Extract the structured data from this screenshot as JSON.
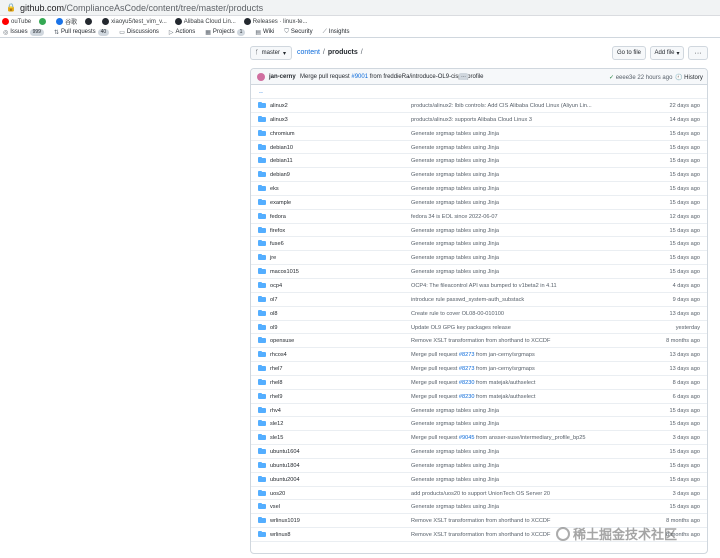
{
  "browser": {
    "host": "github.com",
    "path": "/ComplianceAsCode/content/tree/master/products"
  },
  "bookmarks": [
    {
      "label": "ouTube",
      "icon": "youtube-icon",
      "color": "#ff0000"
    },
    {
      "label": "",
      "icon": "maps-pin-icon",
      "color": "#34a853"
    },
    {
      "label": "谷歌",
      "icon": "translate-icon",
      "color": "#1a73e8"
    },
    {
      "label": "",
      "icon": "github-icon",
      "color": "#24292f"
    },
    {
      "label": "xiaoyu5/test_vim_v...",
      "icon": "github-icon",
      "color": "#24292f"
    },
    {
      "label": "Alibaba Cloud Lin...",
      "icon": "github-icon",
      "color": "#24292f"
    },
    {
      "label": "Releases · linux-te...",
      "icon": "github-icon",
      "color": "#24292f"
    }
  ],
  "repo_tabs": [
    {
      "label": "Issues",
      "count": "999",
      "icon": "issue-icon"
    },
    {
      "label": "Pull requests",
      "count": "40",
      "icon": "pull-request-icon"
    },
    {
      "label": "Discussions",
      "count": "",
      "icon": "discussion-icon"
    },
    {
      "label": "Actions",
      "count": "",
      "icon": "play-icon"
    },
    {
      "label": "Projects",
      "count": "1",
      "icon": "table-icon"
    },
    {
      "label": "Wiki",
      "count": "",
      "icon": "book-icon"
    },
    {
      "label": "Security",
      "count": "",
      "icon": "shield-icon"
    },
    {
      "label": "Insights",
      "count": "",
      "icon": "graph-icon"
    }
  ],
  "pathbar": {
    "branch": "master",
    "repo": "content",
    "separator": "/",
    "current": "products",
    "trailing": "/",
    "go_to_file": "Go to file",
    "add_file": "Add file",
    "more": "···"
  },
  "commit": {
    "author": "jan-cerny",
    "message_pre": "Merge pull request",
    "pr": "#9001",
    "message_post": "from freddieRa/introduce-OL9-cispp-profile",
    "check": "✓",
    "sha": "eeee3e",
    "age": "22 hours ago",
    "history": "History"
  },
  "up_row": "..",
  "files": [
    {
      "name": "alinux2",
      "msg": "products/alinux2: lbib controls: Add CIS Alibaba Cloud Linux (Aliyun Lin...",
      "age": "22 days ago"
    },
    {
      "name": "alinux3",
      "msg": "products/alinux3: supports Alibaba Cloud Linux 3",
      "age": "14 days ago"
    },
    {
      "name": "chromium",
      "msg": "Generate srgmap tables using Jinja",
      "age": "15 days ago"
    },
    {
      "name": "debian10",
      "msg": "Generate srgmap tables using Jinja",
      "age": "15 days ago"
    },
    {
      "name": "debian11",
      "msg": "Generate srgmap tables using Jinja",
      "age": "15 days ago"
    },
    {
      "name": "debian9",
      "msg": "Generate srgmap tables using Jinja",
      "age": "15 days ago"
    },
    {
      "name": "eks",
      "msg": "Generate srgmap tables using Jinja",
      "age": "15 days ago"
    },
    {
      "name": "example",
      "msg": "Generate srgmap tables using Jinja",
      "age": "15 days ago"
    },
    {
      "name": "fedora",
      "msg": "fedora 34 is EOL since 2022-06-07",
      "age": "12 days ago"
    },
    {
      "name": "firefox",
      "msg": "Generate srgmap tables using Jinja",
      "age": "15 days ago"
    },
    {
      "name": "fuse6",
      "msg": "Generate srgmap tables using Jinja",
      "age": "15 days ago"
    },
    {
      "name": "jre",
      "msg": "Generate srgmap tables using Jinja",
      "age": "15 days ago"
    },
    {
      "name": "macos1015",
      "msg": "Generate srgmap tables using Jinja",
      "age": "15 days ago"
    },
    {
      "name": "ocp4",
      "msg": "OCP4: The fileacontrol API was bumped to v1beta2 in 4.11",
      "age": "4 days ago"
    },
    {
      "name": "ol7",
      "msg": "introduce rule passwd_system-auth_substack",
      "age": "9 days ago"
    },
    {
      "name": "ol8",
      "msg": "Create rule to cover OL08-00-010100",
      "age": "13 days ago"
    },
    {
      "name": "ol9",
      "msg": "Update OL9 GPG key packages release",
      "age": "yesterday"
    },
    {
      "name": "opensuse",
      "msg": "Remove XSLT transformation from shorthand to XCCDF",
      "age": "8 months ago"
    },
    {
      "name": "rhcos4",
      "msg": "Merge pull request #8273 from jan-cerny/srgmaps",
      "age": "13 days ago"
    },
    {
      "name": "rhel7",
      "msg": "Merge pull request #8273 from jan-cerny/srgmaps",
      "age": "13 days ago"
    },
    {
      "name": "rhel8",
      "msg": "Merge pull request #8230 from matejak/authselect",
      "age": "8 days ago"
    },
    {
      "name": "rhel9",
      "msg": "Merge pull request #8230 from matejak/authselect",
      "age": "6 days ago"
    },
    {
      "name": "rhv4",
      "msg": "Generate srgmap tables using Jinja",
      "age": "15 days ago"
    },
    {
      "name": "sle12",
      "msg": "Generate srgmap tables using Jinja",
      "age": "15 days ago"
    },
    {
      "name": "sle15",
      "msg": "Merge pull request #9045 from ansser-suse/intermediary_profile_bp25",
      "age": "3 days ago"
    },
    {
      "name": "ubuntu1604",
      "msg": "Generate srgmap tables using Jinja",
      "age": "15 days ago"
    },
    {
      "name": "ubuntu1804",
      "msg": "Generate srgmap tables using Jinja",
      "age": "15 days ago"
    },
    {
      "name": "ubuntu2004",
      "msg": "Generate srgmap tables using Jinja",
      "age": "15 days ago"
    },
    {
      "name": "uos20",
      "msg": "add products/uos20 to support UnionTech OS Server 20",
      "age": "3 days ago"
    },
    {
      "name": "vsel",
      "msg": "Generate srgmap tables using Jinja",
      "age": "15 days ago"
    },
    {
      "name": "wrlinux1019",
      "msg": "Remove XSLT transformation from shorthand to XCCDF",
      "age": "8 months ago"
    },
    {
      "name": "wrlinux8",
      "msg": "Remove XSLT transformation from shorthand to XCCDF",
      "age": "8 months ago"
    }
  ],
  "watermark": "稀土掘金技术社区"
}
